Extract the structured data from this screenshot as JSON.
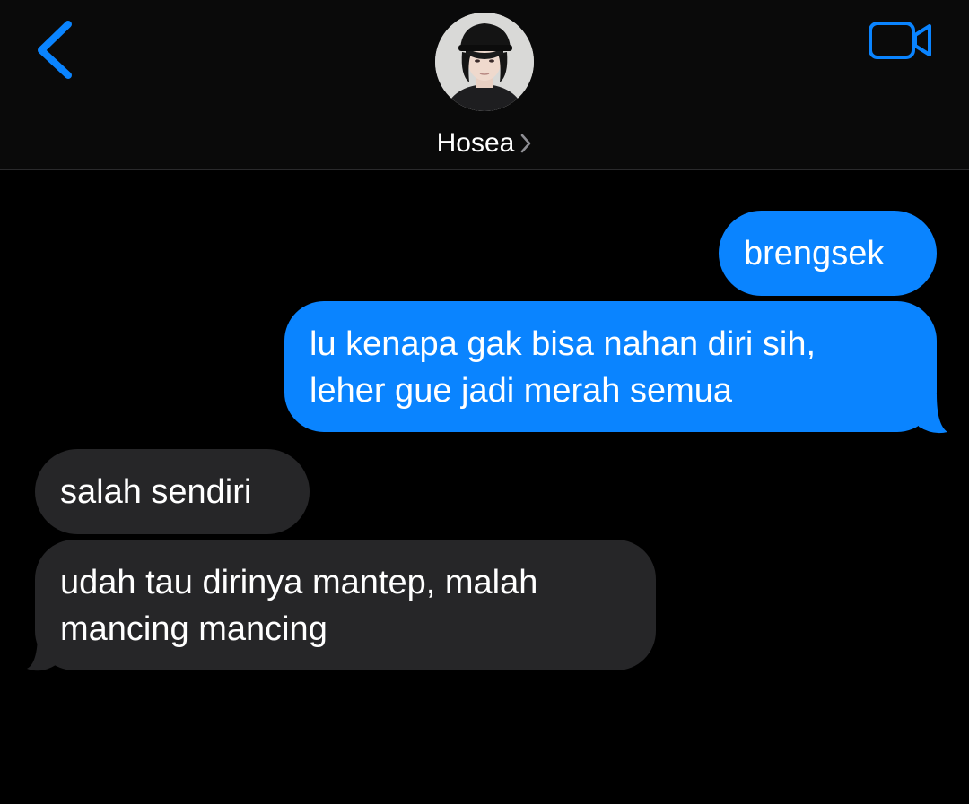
{
  "header": {
    "contact_name": "Hosea",
    "back_icon": "chevron-left-icon",
    "video_icon": "video-camera-icon",
    "chevron_icon": "chevron-right-icon"
  },
  "messages": [
    {
      "direction": "sent",
      "lines": [
        "brengsek"
      ]
    },
    {
      "direction": "sent",
      "lines": [
        "lu kenapa gak bisa nahan diri sih,",
        "leher gue jadi merah semua"
      ]
    },
    {
      "direction": "received",
      "lines": [
        "salah sendiri"
      ]
    },
    {
      "direction": "received",
      "lines": [
        "udah tau dirinya mantep, malah",
        "mancing mancing"
      ]
    }
  ],
  "colors": {
    "accent": "#0a84ff",
    "sent_bubble": "#0a84ff",
    "received_bubble": "#262628",
    "background": "#000000",
    "text": "#ffffff"
  }
}
